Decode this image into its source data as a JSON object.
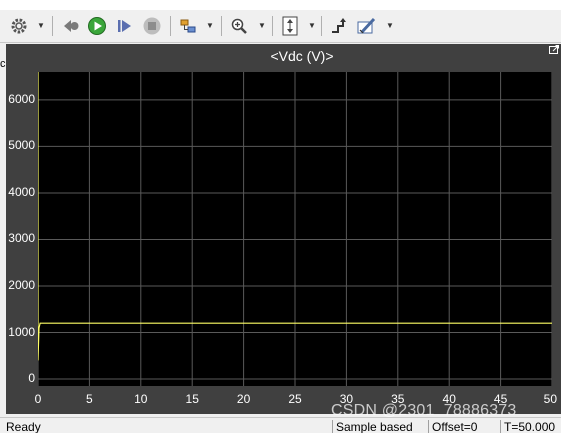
{
  "toolbar": {
    "icons": [
      "settings-gear-icon",
      "step-back-icon",
      "run-icon",
      "step-forward-icon",
      "stop-icon",
      "highlight-block-icon",
      "zoom-in-icon",
      "autoscale-icon",
      "cursor-measure-icon",
      "edit-properties-icon"
    ]
  },
  "scope": {
    "title": "<Vdc (V)>"
  },
  "status": {
    "ready": "Ready",
    "sample_based": "Sample based",
    "offset": "Offset=0",
    "time": "T=50.000"
  },
  "watermark": "CSDN @2301_78886373",
  "colors": {
    "plot_bg": "#000000",
    "frame_bg": "#404040",
    "grid": "#5a5a5a",
    "trace": "#ffff66",
    "tick_text": "#ffffff"
  },
  "chart_data": {
    "type": "line",
    "title": "<Vdc (V)>",
    "xlabel": "",
    "ylabel": "",
    "xlim": [
      0,
      50
    ],
    "ylim": [
      -150,
      6600
    ],
    "xticks": [
      "0",
      "5",
      "10",
      "15",
      "20",
      "25",
      "30",
      "35",
      "40",
      "45",
      "50"
    ],
    "yticks": [
      "0",
      "1000",
      "2000",
      "3000",
      "4000",
      "5000",
      "6000"
    ],
    "grid": true,
    "series": [
      {
        "x": [
          0,
          0,
          0.1,
          0.2,
          0.3,
          1,
          5,
          10,
          20,
          30,
          40,
          50
        ],
        "y": [
          6600,
          400,
          1100,
          1200,
          1200,
          1200,
          1200,
          1200,
          1200,
          1200,
          1200,
          1200
        ]
      }
    ]
  }
}
